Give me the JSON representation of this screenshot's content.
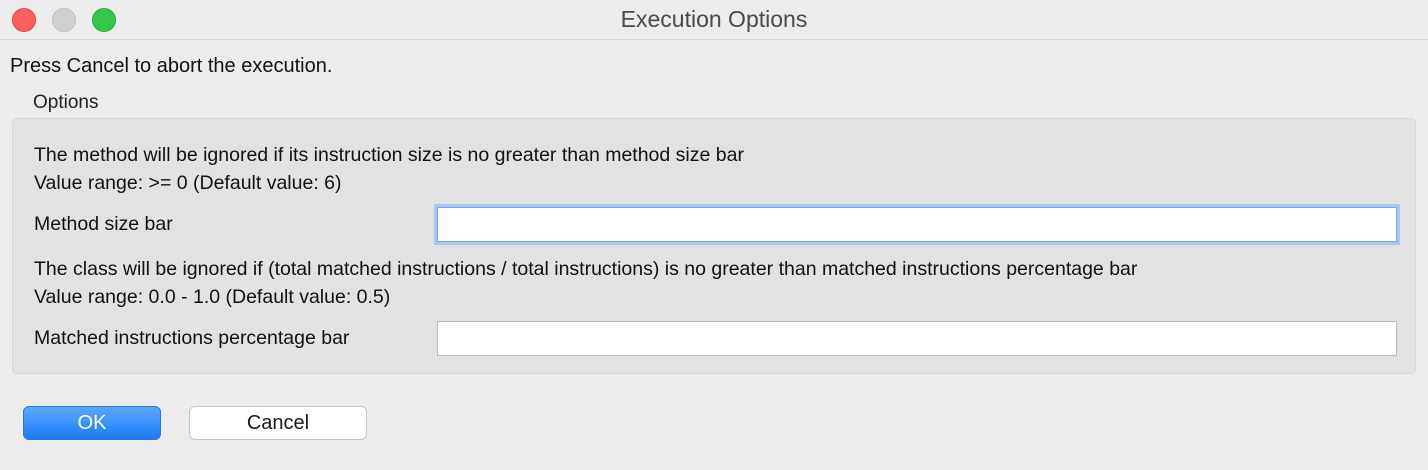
{
  "window": {
    "title": "Execution Options"
  },
  "hint": "Press Cancel to abort the execution.",
  "options": {
    "group_label": "Options",
    "method": {
      "description": "The method will be ignored if its instruction size is no greater than method size bar",
      "range": "Value range: >= 0 (Default value: 6)",
      "label": "Method size bar",
      "value": ""
    },
    "klass": {
      "description": "The class will be ignored if (total matched instructions / total instructions) is no greater than matched instructions percentage bar",
      "range": "Value range: 0.0 - 1.0 (Default value: 0.5)",
      "label": "Matched instructions percentage bar",
      "value": ""
    }
  },
  "buttons": {
    "ok": "OK",
    "cancel": "Cancel"
  },
  "colors": {
    "accent": "#1a7cf5",
    "focus_ring": "#a8c8ef",
    "close": "#fc605c",
    "maximize": "#34c84a"
  }
}
